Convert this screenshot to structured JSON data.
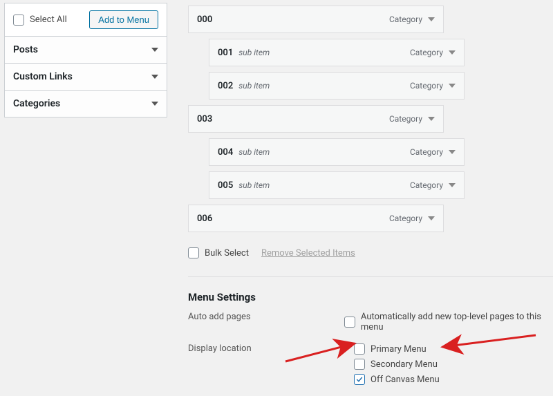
{
  "sidebar": {
    "selectAll": "Select All",
    "addToMenu": "Add to Menu",
    "sections": [
      "Posts",
      "Custom Links",
      "Categories"
    ]
  },
  "menuItems": [
    {
      "title": "000",
      "sub": "",
      "type": "Category",
      "indent": false
    },
    {
      "title": "001",
      "sub": "sub item",
      "type": "Category",
      "indent": true
    },
    {
      "title": "002",
      "sub": "sub item",
      "type": "Category",
      "indent": true
    },
    {
      "title": "003",
      "sub": "",
      "type": "Category",
      "indent": false
    },
    {
      "title": "004",
      "sub": "sub item",
      "type": "Category",
      "indent": true
    },
    {
      "title": "005",
      "sub": "sub item",
      "type": "Category",
      "indent": true
    },
    {
      "title": "006",
      "sub": "",
      "type": "Category",
      "indent": false
    }
  ],
  "bulk": {
    "bulkSelect": "Bulk Select",
    "removeSelected": "Remove Selected Items"
  },
  "settings": {
    "heading": "Menu Settings",
    "autoAddLabel": "Auto add pages",
    "autoAddOption": "Automatically add new top-level pages to this menu",
    "displayLabel": "Display location",
    "locations": [
      {
        "label": "Primary Menu",
        "checked": false
      },
      {
        "label": "Secondary Menu",
        "checked": false
      },
      {
        "label": "Off Canvas Menu",
        "checked": true
      }
    ]
  }
}
